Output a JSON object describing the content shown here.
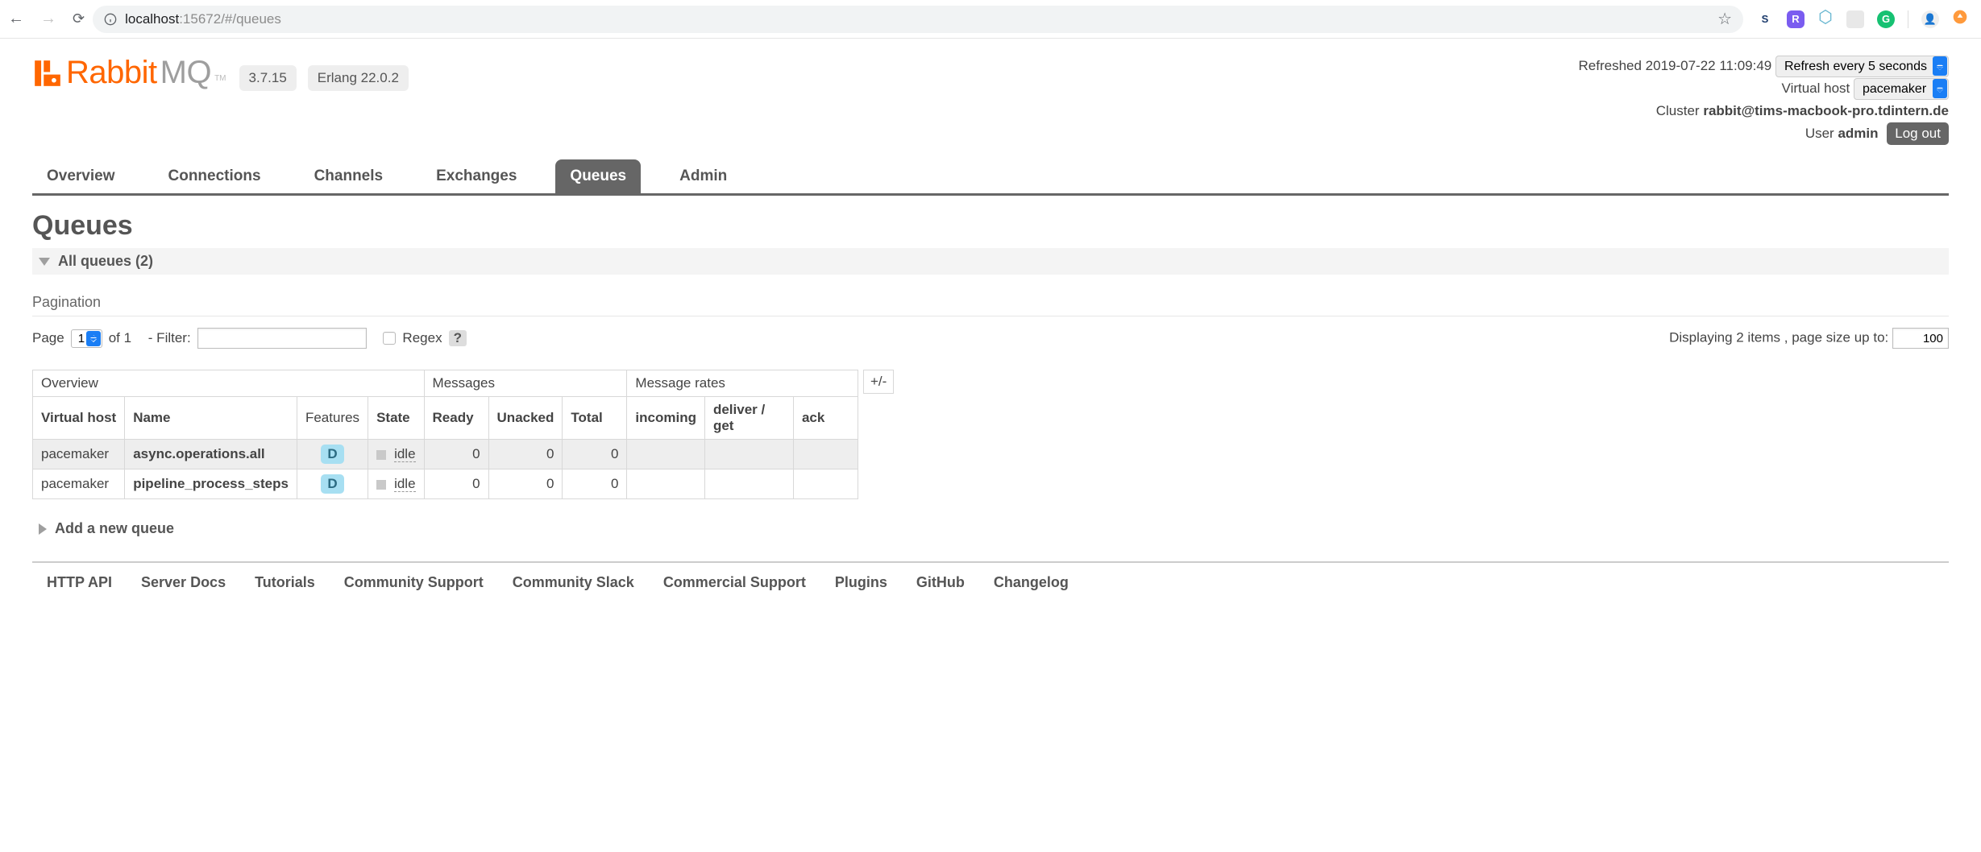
{
  "browser": {
    "url_host": "localhost",
    "url_port": ":15672",
    "url_path": "/#/queues"
  },
  "logo": {
    "part1": "Rabbit",
    "part2": "MQ"
  },
  "version": {
    "app": "3.7.15",
    "erlang": "Erlang 22.0.2"
  },
  "top_right": {
    "refreshed_label": "Refreshed 2019-07-22 11:09:49",
    "refresh_select": "Refresh every 5 seconds",
    "vhost_label": "Virtual host",
    "vhost_value": "pacemaker",
    "cluster_label": "Cluster",
    "cluster_value": "rabbit@tims-macbook-pro.tdintern.de",
    "user_label": "User",
    "user_value": "admin",
    "logout": "Log out"
  },
  "tabs": [
    "Overview",
    "Connections",
    "Channels",
    "Exchanges",
    "Queues",
    "Admin"
  ],
  "active_tab_index": 4,
  "page_title": "Queues",
  "section_all": "All queues (2)",
  "pagination": {
    "label": "Pagination",
    "page_label": "Page",
    "page_value": "1",
    "of_label": "of 1",
    "filter_label": "- Filter:",
    "filter_value": "",
    "regex_label": "Regex",
    "regex_help": "?",
    "displaying": "Displaying 2 items , page size up to:",
    "page_size": "100"
  },
  "table": {
    "groups": [
      "Overview",
      "Messages",
      "Message rates"
    ],
    "cols_overview": [
      "Virtual host",
      "Name",
      "Features",
      "State"
    ],
    "cols_messages": [
      "Ready",
      "Unacked",
      "Total"
    ],
    "cols_rates": [
      "incoming",
      "deliver / get",
      "ack"
    ],
    "rows": [
      {
        "vhost": "pacemaker",
        "name": "async.operations.all",
        "feature": "D",
        "state": "idle",
        "ready": "0",
        "unacked": "0",
        "total": "0",
        "incoming": "",
        "deliver": "",
        "ack": ""
      },
      {
        "vhost": "pacemaker",
        "name": "pipeline_process_steps",
        "feature": "D",
        "state": "idle",
        "ready": "0",
        "unacked": "0",
        "total": "0",
        "incoming": "",
        "deliver": "",
        "ack": ""
      }
    ],
    "plus_minus": "+/-"
  },
  "add_queue": "Add a new queue",
  "footer": [
    "HTTP API",
    "Server Docs",
    "Tutorials",
    "Community Support",
    "Community Slack",
    "Commercial Support",
    "Plugins",
    "GitHub",
    "Changelog"
  ]
}
